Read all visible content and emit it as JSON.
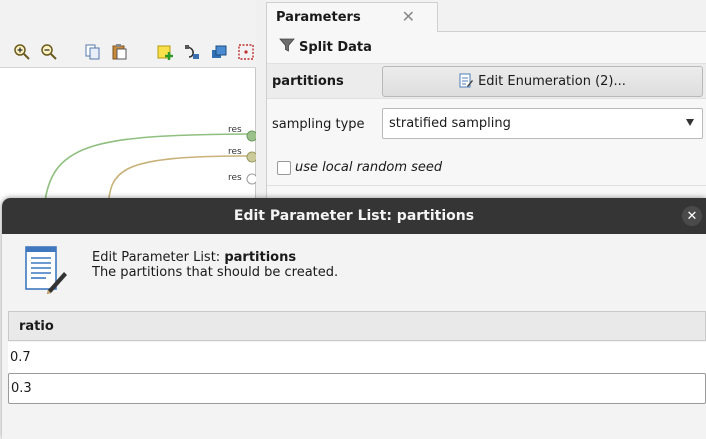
{
  "process": {
    "port_labels": [
      "res",
      "res",
      "res"
    ]
  },
  "parameters_panel": {
    "tab_title": "Parameters",
    "tab_close": "✕",
    "operator_name": "Split Data",
    "rows": {
      "partitions_label": "partitions",
      "partitions_button": "Edit Enumeration (2)...",
      "sampling_label": "sampling type",
      "sampling_value": "stratified sampling",
      "seed_label": "use local random seed",
      "seed_checked": false
    }
  },
  "dialog": {
    "title": "Edit Parameter List: partitions",
    "close": "✕",
    "heading_prefix": "Edit Parameter List:",
    "heading_param": "partitions",
    "description": "The partitions that should be created.",
    "table": {
      "column": "ratio",
      "rows": [
        "0.7",
        "0.3"
      ]
    }
  },
  "colors": {
    "connection_green": "#8fbf7f",
    "connection_tan": "#c8b27a",
    "titlebar": "#353535"
  }
}
